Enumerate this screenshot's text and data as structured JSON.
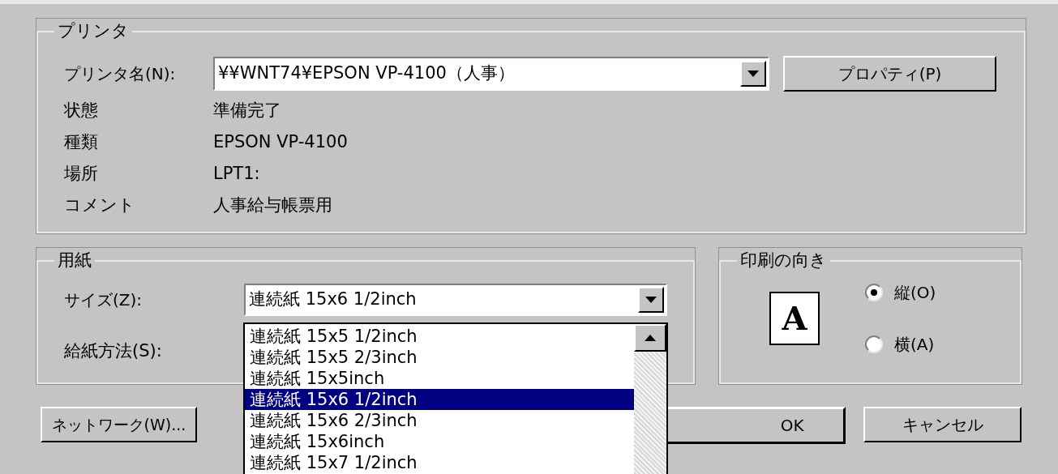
{
  "printer_group": {
    "title": "プリンタ",
    "name_label": "プリンタ名(N):",
    "name_value": "¥¥WNT74¥EPSON VP-4100（人事）",
    "properties_button": "プロパティ(P)",
    "info": [
      {
        "label": "状態",
        "value": "準備完了"
      },
      {
        "label": "種類",
        "value": "EPSON VP-4100"
      },
      {
        "label": "場所",
        "value": "LPT1:"
      },
      {
        "label": "コメント",
        "value": "人事給与帳票用"
      }
    ]
  },
  "paper_group": {
    "title": "用紙",
    "size_label": "サイズ(Z):",
    "size_value": "連続紙 15x6 1/2inch",
    "source_label": "給紙方法(S):"
  },
  "size_dropdown": [
    {
      "label": "連続紙 15x5 1/2inch",
      "selected": false
    },
    {
      "label": "連続紙 15x5 2/3inch",
      "selected": false
    },
    {
      "label": "連続紙 15x5inch",
      "selected": false
    },
    {
      "label": "連続紙 15x6 1/2inch",
      "selected": true
    },
    {
      "label": "連続紙 15x6 2/3inch",
      "selected": false
    },
    {
      "label": "連続紙 15x6inch",
      "selected": false
    },
    {
      "label": "連続紙 15x7 1/2inch",
      "selected": false
    }
  ],
  "orientation_group": {
    "title": "印刷の向き",
    "preview_letter": "A",
    "options": [
      {
        "label": "縦(O)",
        "selected": true
      },
      {
        "label": "横(A)",
        "selected": false
      }
    ]
  },
  "buttons": {
    "network": "ネットワーク(W)...",
    "ok": "OK",
    "cancel": "キャンセル"
  }
}
